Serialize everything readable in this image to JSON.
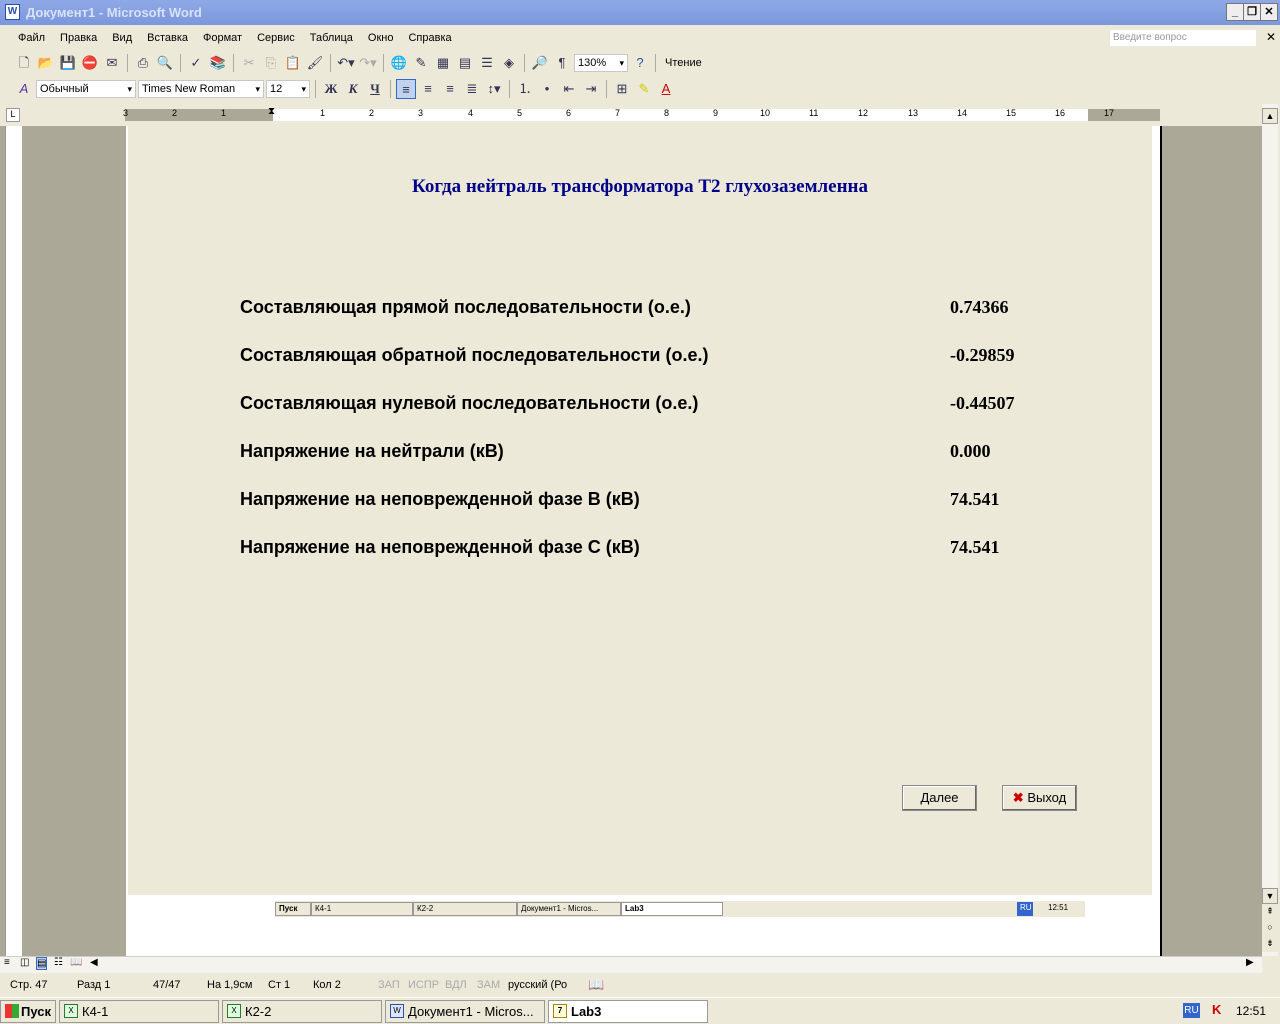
{
  "window": {
    "title": "Документ1 - Microsoft Word"
  },
  "menu": [
    "Файл",
    "Правка",
    "Вид",
    "Вставка",
    "Формат",
    "Сервис",
    "Таблица",
    "Окно",
    "Справка"
  ],
  "help_placeholder": "Введите вопрос",
  "toolbar": {
    "zoom": "130%",
    "reading": "Чтение",
    "style": "Обычный",
    "font": "Times New Roman",
    "size": "12",
    "bold": "Ж",
    "italic": "К",
    "underline": "Ч"
  },
  "ruler": [
    "3",
    "2",
    "1",
    "1",
    "2",
    "3",
    "4",
    "5",
    "6",
    "7",
    "8",
    "9",
    "10",
    "11",
    "12",
    "13",
    "14",
    "15",
    "16",
    "17"
  ],
  "form": {
    "title": "Когда нейтраль трансформатора Т2 глухозаземленна",
    "rows": [
      {
        "label": "Составляющая прямой последовательности (о.е.)",
        "value": "0.74366"
      },
      {
        "label": "Составляющая обратной последовательности (о.е.)",
        "value": "-0.29859"
      },
      {
        "label": "Составляющая нулевой последовательности (о.е.)",
        "value": "-0.44507"
      },
      {
        "label": "Напряжение на нейтрали (кВ)",
        "value": "0.000"
      },
      {
        "label": "Напряжение на неповрежденной фазе В (кВ)",
        "value": "74.541"
      },
      {
        "label": "Напряжение на неповрежденной фазе С (кВ)",
        "value": "74.541"
      }
    ],
    "next": "Далее",
    "exit": "Выход"
  },
  "mini_taskbar": {
    "start": "Пуск",
    "items": [
      "К4-1",
      "К2-2",
      "Документ1 - Micros...",
      "Lab3"
    ],
    "lang": "RU",
    "time": "12:51"
  },
  "status": {
    "page": "Стр. 47",
    "section": "Разд 1",
    "pages": "47/47",
    "at": "На 1,9см",
    "line": "Ст 1",
    "col": "Кол 2",
    "rec": "ЗАП",
    "trk": "ИСПР",
    "ext": "ВДЛ",
    "ovr": "ЗАМ",
    "lang": "русский (Ро"
  },
  "taskbar": {
    "start": "Пуск",
    "items": [
      "К4-1",
      "К2-2",
      "Документ1 - Micros...",
      "Lab3"
    ],
    "lang": "RU",
    "time": "12:51"
  }
}
